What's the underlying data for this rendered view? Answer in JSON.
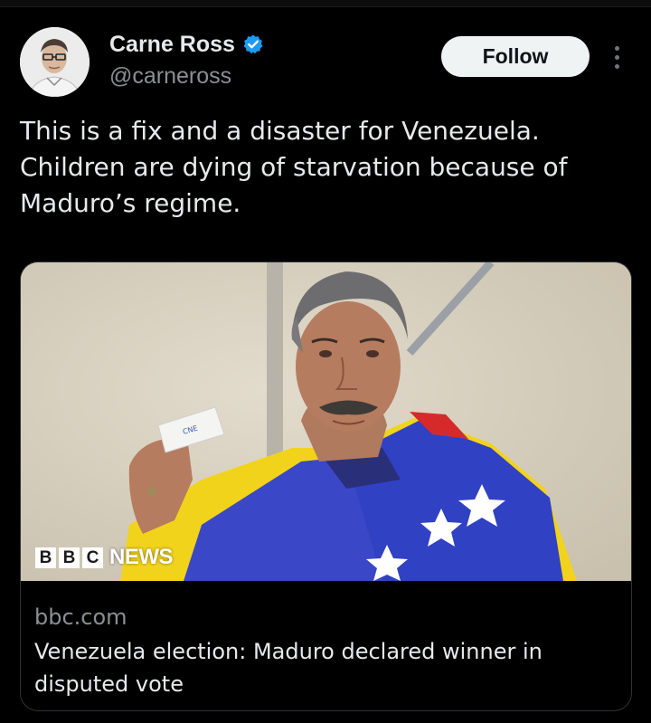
{
  "author": {
    "display_name": "Carne Ross",
    "handle": "@carneross",
    "verified": true,
    "verified_color": "#1d9bf0",
    "avatar_icon": "profile-photo"
  },
  "actions": {
    "follow_label": "Follow",
    "more_icon": "vertical-ellipsis-icon"
  },
  "tweet": {
    "text": "This is a fix and a disaster for Venezuela. Children are dying of starvation because of Maduro’s regime."
  },
  "link_card": {
    "image_logo_blocks": [
      "B",
      "B",
      "C"
    ],
    "image_logo_word": "NEWS",
    "domain": "bbc.com",
    "title": "Venezuela election: Maduro declared winner in disputed vote"
  },
  "colors": {
    "background": "#000000",
    "text_primary": "#e7e9ea",
    "text_secondary": "#8b8f94",
    "follow_bg": "#eff3f4",
    "card_border": "#2f3336"
  }
}
